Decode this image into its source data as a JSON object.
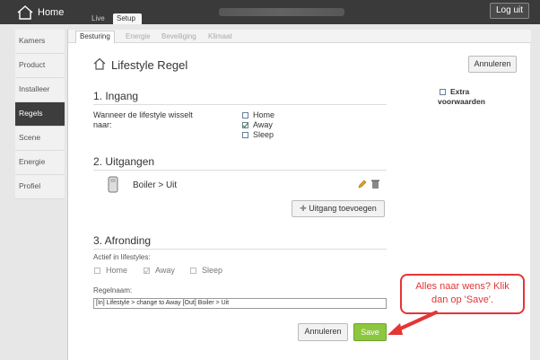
{
  "header": {
    "app_name": "Home",
    "logout_label": "Log uit",
    "tabs": [
      {
        "label": "Live"
      },
      {
        "label": "Setup"
      }
    ]
  },
  "sidebar": {
    "items": [
      {
        "label": "Kamers"
      },
      {
        "label": "Product"
      },
      {
        "label": "Installeer"
      },
      {
        "label": "Regels"
      },
      {
        "label": "Scene"
      },
      {
        "label": "Energie"
      },
      {
        "label": "Profiel"
      }
    ],
    "active_index": 3
  },
  "subtabs": [
    {
      "label": "Besturing"
    },
    {
      "label": "Energie"
    },
    {
      "label": "Beveiliging"
    },
    {
      "label": "Klimaat"
    }
  ],
  "page": {
    "title": "Lifestyle Regel",
    "cancel_top_label": "Annuleren",
    "extra_conditions_label_1": "Extra",
    "extra_conditions_label_2": "voorwaarden",
    "section1": {
      "heading": "1. Ingang",
      "prompt_line1": "Wanneer de lifestyle wisselt",
      "prompt_line2": "naar:",
      "options": [
        {
          "label": "Home",
          "checked": false
        },
        {
          "label": "Away",
          "checked": true
        },
        {
          "label": "Sleep",
          "checked": false
        }
      ]
    },
    "section2": {
      "heading": "2. Uitgangen",
      "output_label": "Boiler > Uit",
      "add_output_label": "Uitgang toevoegen"
    },
    "section3": {
      "heading": "3. Afronding",
      "active_in_label": "Actief in lifestyles:",
      "lifestyles": [
        {
          "label": "Home",
          "checked": false
        },
        {
          "label": "Away",
          "checked": true
        },
        {
          "label": "Sleep",
          "checked": false
        }
      ],
      "rule_name_label": "Regelnaam:",
      "rule_name_value": "[In] Lifestyle > change to Away  [Out] Boiler > Uit"
    },
    "cancel_bottom_label": "Annuleren",
    "save_label": "Save"
  },
  "callout": {
    "line1": "Alles naar wens? Klik",
    "line2": "dan op 'Save'."
  },
  "colors": {
    "topbar": "#3a3a3a",
    "save": "#8dc63f",
    "callout": "#e53535",
    "active_sidebar": "#3d3d3d"
  }
}
